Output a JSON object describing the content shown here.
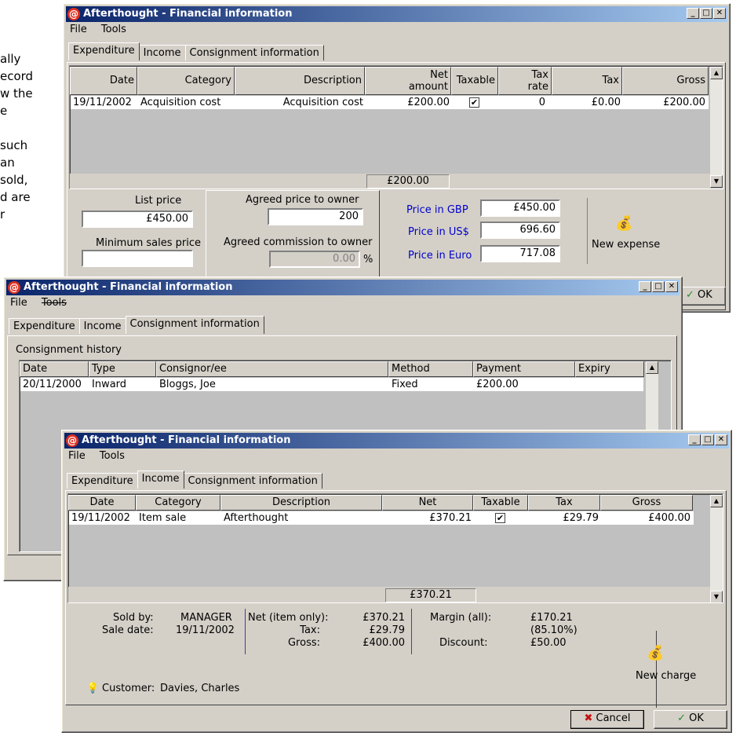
{
  "background_text": [
    "ally",
    "ecord",
    "w the",
    "e",
    "",
    "such",
    "an",
    "sold,",
    "d are",
    "r"
  ],
  "window_title": "Afterthought - Financial information",
  "window_buttons": {
    "minimize": "_",
    "maximize": "□",
    "close": "✕"
  },
  "menu": {
    "file": "File",
    "tools": "Tools"
  },
  "tabs": {
    "expenditure": "Expenditure",
    "income": "Income",
    "consignment": "Consignment information"
  },
  "expenditure": {
    "columns": [
      "Date",
      "Category",
      "Description",
      "Net amount",
      "Taxable",
      "Tax rate",
      "Tax",
      "Gross"
    ],
    "col_net_1": "Net",
    "col_net_2": "amount",
    "col_taxrate_1": "Tax",
    "col_taxrate_2": "rate",
    "rows": [
      {
        "date": "19/11/2002",
        "category": "Acquisition cost",
        "description": "Acquisition cost",
        "net": "£200.00",
        "taxable": true,
        "tax_rate": "0",
        "tax": "£0.00",
        "gross": "£200.00"
      }
    ],
    "total": "£200.00",
    "list_price_label": "List price",
    "list_price": "£450.00",
    "min_sales_label": "Minimum sales price",
    "min_sales": "",
    "agreed_price_label": "Agreed price to owner",
    "agreed_price": "200",
    "agreed_comm_label": "Agreed commission to owner",
    "agreed_comm": "0.00",
    "percent": "%",
    "price_gbp_label": "Price in GBP",
    "price_gbp": "£450.00",
    "price_usd_label": "Price in US$",
    "price_usd": "696.60",
    "price_eur_label": "Price in Euro",
    "price_eur": "717.08",
    "new_expense": "New expense",
    "ok_partial": "OK"
  },
  "consignment": {
    "history_label": "Consignment history",
    "columns": [
      "Date",
      "Type",
      "Consignor/ee",
      "Method",
      "Payment",
      "Expiry"
    ],
    "rows": [
      {
        "date": "20/11/2000",
        "type": "Inward",
        "consignor": "Bloggs, Joe",
        "method": "Fixed",
        "payment": "£200.00",
        "expiry": ""
      }
    ]
  },
  "income": {
    "columns": [
      "Date",
      "Category",
      "Description",
      "Net",
      "Taxable",
      "Tax",
      "Gross"
    ],
    "rows": [
      {
        "date": "19/11/2002",
        "category": "Item sale",
        "description": "Afterthought",
        "net": "£370.21",
        "taxable": true,
        "tax": "£29.79",
        "gross": "£400.00"
      }
    ],
    "total": "£370.21",
    "sold_by_label": "Sold by:",
    "sold_by": "MANAGER",
    "sale_date_label": "Sale date:",
    "sale_date": "19/11/2002",
    "net_item_label": "Net (item only):",
    "net_item": "£370.21",
    "tax_label": "Tax:",
    "tax": "£29.79",
    "gross_label": "Gross:",
    "gross": "£400.00",
    "margin_label": "Margin (all):",
    "margin": "£170.21",
    "margin_pct": "(85.10%)",
    "discount_label": "Discount:",
    "discount": "£50.00",
    "customer_label": "Customer:",
    "customer": "Davies, Charles",
    "new_charge": "New charge",
    "cancel": "Cancel",
    "ok": "OK"
  }
}
